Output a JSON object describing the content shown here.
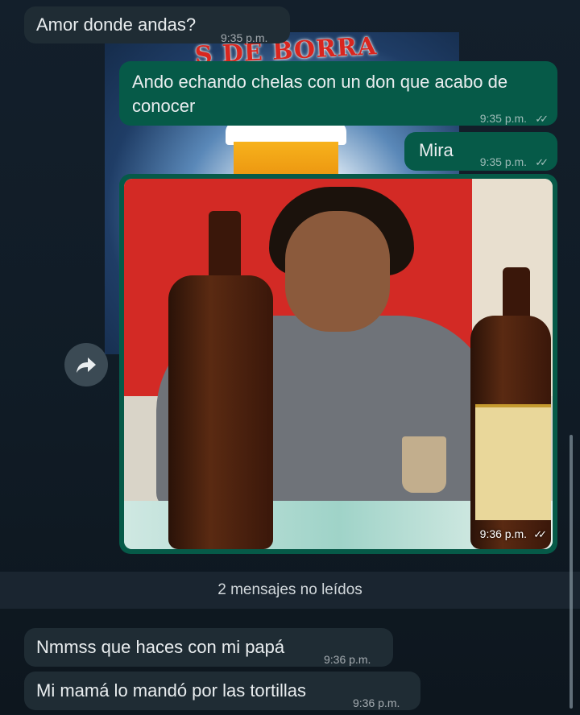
{
  "poster": {
    "text": "S DE BORRA"
  },
  "messages": [
    {
      "id": "m1",
      "direction": "incoming",
      "text": "Amor donde andas?",
      "time": "9:35 p.m."
    },
    {
      "id": "m2",
      "direction": "outgoing",
      "text": "Ando echando chelas con un don que acabo de conocer",
      "time": "9:35 p.m.",
      "status": "read"
    },
    {
      "id": "m3",
      "direction": "outgoing",
      "text": "Mira",
      "time": "9:35 p.m.",
      "status": "read"
    },
    {
      "id": "m4",
      "direction": "outgoing",
      "type": "photo",
      "time": "9:36 p.m.",
      "status": "read"
    }
  ],
  "ticks_glyph": "✓✓",
  "unread_divider": "2 mensajes no leídos",
  "new_messages": [
    {
      "id": "m5",
      "direction": "incoming",
      "text": "Nmmss que haces con mi papá",
      "time": "9:36 p.m."
    },
    {
      "id": "m6",
      "direction": "incoming",
      "text": "Mi mamá lo mandó por las tortillas",
      "time": "9:36 p.m."
    }
  ],
  "icons": {
    "forward": "forward-arrow-icon",
    "read_receipt": "double-check-icon"
  },
  "colors": {
    "incoming_bubble": "#1f2c34",
    "outgoing_bubble": "#065a48",
    "background": "#0e1821"
  }
}
